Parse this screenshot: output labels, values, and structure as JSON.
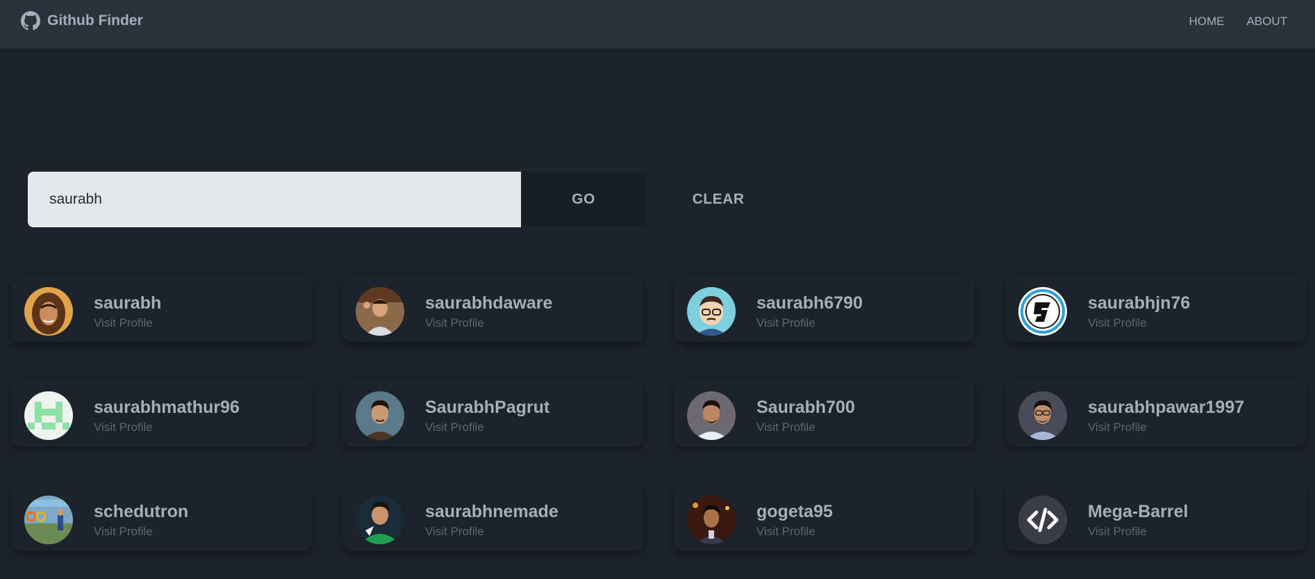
{
  "navbar": {
    "brand": "Github Finder",
    "brand_icon": "github-icon",
    "links": [
      {
        "label": "HOME"
      },
      {
        "label": "ABOUT"
      }
    ]
  },
  "search": {
    "value": "saurabh",
    "placeholder": "Search",
    "go_label": "GO",
    "clear_label": "CLEAR"
  },
  "users": [
    {
      "login": "saurabh",
      "link_label": "Visit Profile"
    },
    {
      "login": "saurabhdaware",
      "link_label": "Visit Profile"
    },
    {
      "login": "saurabh6790",
      "link_label": "Visit Profile"
    },
    {
      "login": "saurabhjn76",
      "link_label": "Visit Profile"
    },
    {
      "login": "saurabhmathur96",
      "link_label": "Visit Profile"
    },
    {
      "login": "SaurabhPagrut",
      "link_label": "Visit Profile"
    },
    {
      "login": "Saurabh700",
      "link_label": "Visit Profile"
    },
    {
      "login": "saurabhpawar1997",
      "link_label": "Visit Profile"
    },
    {
      "login": "schedutron",
      "link_label": "Visit Profile"
    },
    {
      "login": "saurabhnemade",
      "link_label": "Visit Profile"
    },
    {
      "login": "gogeta95",
      "link_label": "Visit Profile"
    },
    {
      "login": "Mega-Barrel",
      "link_label": "Visit Profile"
    }
  ],
  "colors": {
    "background": "#1d232a",
    "navbar": "#2a323c",
    "text": "#a6adbb",
    "input_bg": "#e5e7eb",
    "button_bg": "#191e24"
  }
}
